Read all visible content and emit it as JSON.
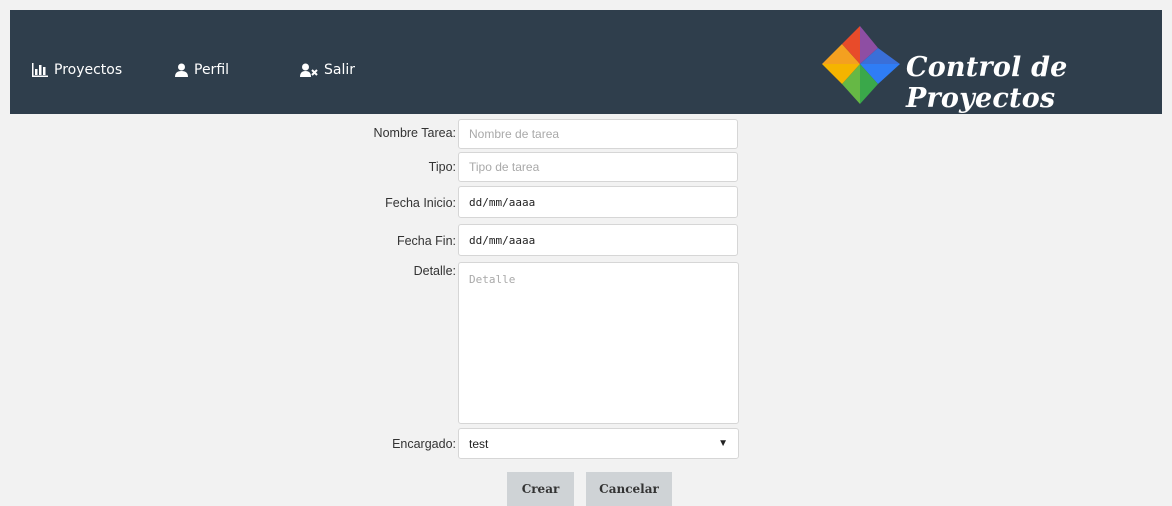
{
  "nav": {
    "items": [
      {
        "label": "Proyectos",
        "icon": "bar-chart-icon"
      },
      {
        "label": "Perfil",
        "icon": "user-icon"
      },
      {
        "label": "Salir",
        "icon": "user-remove-icon"
      }
    ],
    "brand": "Control de Proyectos"
  },
  "form": {
    "nombre": {
      "label": "Nombre Tarea:",
      "placeholder": "Nombre de tarea"
    },
    "tipo": {
      "label": "Tipo:",
      "placeholder": "Tipo de tarea"
    },
    "inicio": {
      "label": "Fecha Inicio:",
      "value": "dd/mm/aaaa"
    },
    "fin": {
      "label": "Fecha Fin:",
      "value": "dd/mm/aaaa"
    },
    "detalle": {
      "label": "Detalle:",
      "placeholder": "Detalle"
    },
    "encargado": {
      "label": "Encargado:",
      "value": "test"
    }
  },
  "buttons": {
    "crear": "Crear",
    "cancelar": "Cancelar"
  },
  "colors": {
    "topbar": "#2f3e4c",
    "background": "#f2f2f2",
    "button": "#cfd3d6"
  }
}
